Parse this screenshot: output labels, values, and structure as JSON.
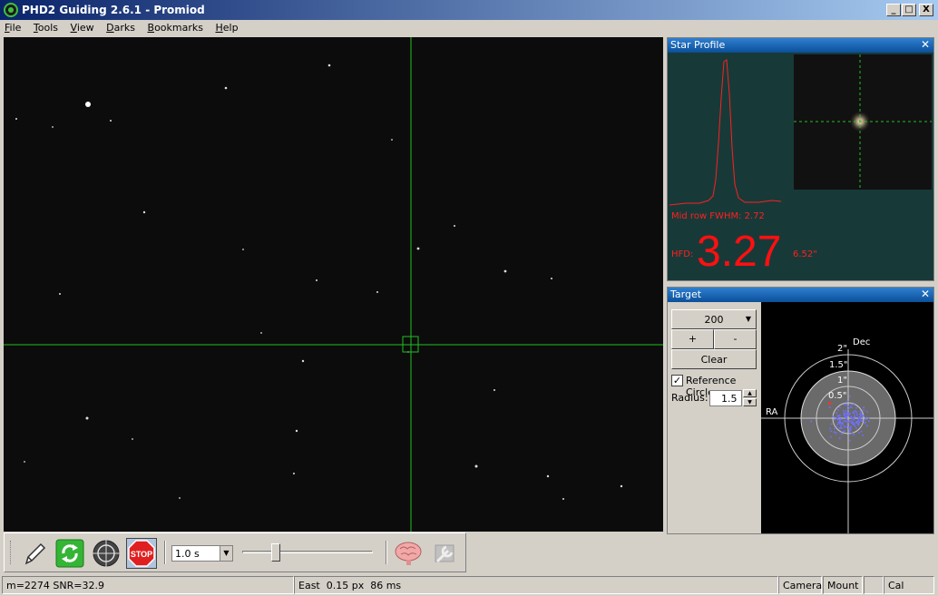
{
  "window": {
    "title": "PHD2 Guiding 2.6.1 - Promiod",
    "buttons": {
      "minimize": "_",
      "maximize": "□",
      "close": "X"
    }
  },
  "menu": [
    {
      "label": "File",
      "ul": "F",
      "rest": "ile"
    },
    {
      "label": "Tools",
      "ul": "T",
      "rest": "ools"
    },
    {
      "label": "View",
      "ul": "V",
      "rest": "iew"
    },
    {
      "label": "Darks",
      "ul": "D",
      "rest": "arks"
    },
    {
      "label": "Bookmarks",
      "ul": "B",
      "rest": "ookmarks"
    },
    {
      "label": "Help",
      "ul": "H",
      "rest": "elp"
    }
  ],
  "star_profile": {
    "title": "Star Profile",
    "close": "✕",
    "fwhm_text": "Mid row FWHM: 2.72",
    "hfd_label": "HFD:",
    "hfd_value": "3.27",
    "hfd_arcsec": "6.52\""
  },
  "target": {
    "title": "Target",
    "close": "✕",
    "length_value": "200",
    "zoom_in": "+",
    "zoom_out": "-",
    "clear": "Clear",
    "reference_circle_label": "Reference Circle",
    "reference_circle_checked": "✓",
    "radius_label": "Radius:",
    "radius_value": "1.5",
    "axis_dec": "Dec",
    "axis_ra": "RA",
    "ring_labels": [
      "2\"",
      "1.5\"",
      "1\"",
      "0.5\""
    ]
  },
  "toolbar": {
    "exposure": "1.0 s",
    "icons": [
      "pencil-icon",
      "loop-icon",
      "guide-target-icon",
      "stop-icon",
      "brain-icon",
      "settings-icon"
    ],
    "stop_label": "STOP"
  },
  "status": {
    "star_info": "m=2274 SNR=32.9",
    "guide_info": "East  0.15 px  86 ms",
    "camera": "Camera",
    "mount": "Mount",
    "cal": "Cal"
  },
  "colors": {
    "crosshair": "#22c022",
    "profile_line": "#ff2020",
    "scatter": "#7070ff"
  }
}
